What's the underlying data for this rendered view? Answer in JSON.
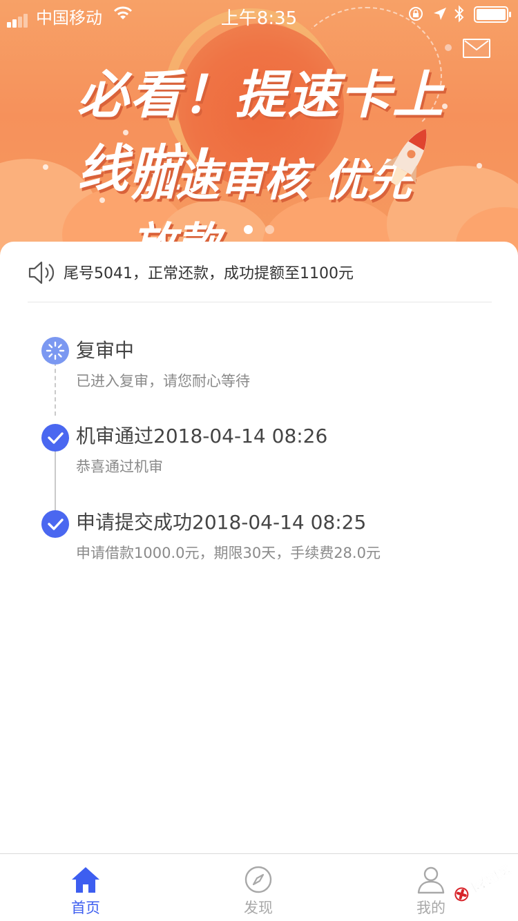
{
  "status_bar": {
    "carrier": "中国移动",
    "time": "上午8:35"
  },
  "banner": {
    "headline": "必看！提速卡上线啦！",
    "subline": "加速审核 优先放款",
    "slides_total": 2,
    "active_slide": 1
  },
  "notice": {
    "icon": "speaker-icon",
    "text": "尾号5041，正常还款，成功提额至1100元"
  },
  "timeline": {
    "steps": [
      {
        "status": "pending",
        "title": "复审中",
        "desc": "已进入复审，请您耐心等待"
      },
      {
        "status": "done",
        "title": "机审通过2018-04-14 08:26",
        "desc": "恭喜通过机审"
      },
      {
        "status": "done",
        "title": "申请提交成功2018-04-14 08:25",
        "desc": "申请借款1000.0元，期限30天，手续费28.0元"
      }
    ]
  },
  "tabbar": {
    "tabs": [
      {
        "label": "首页",
        "icon": "home-icon",
        "active": true
      },
      {
        "label": "发现",
        "icon": "compass-icon",
        "active": false
      },
      {
        "label": "我的",
        "icon": "user-icon",
        "active": false
      }
    ]
  },
  "watermark": {
    "text": "卡农社区"
  },
  "colors": {
    "accent": "#4a67f0",
    "pending": "#7b98f1",
    "banner": "#f6915b"
  }
}
